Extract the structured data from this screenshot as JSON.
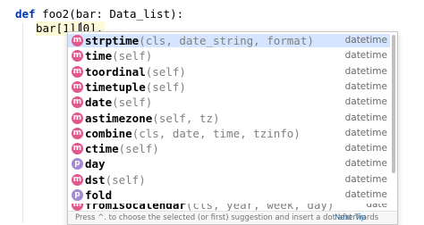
{
  "editor": {
    "line1": {
      "keyword": "def",
      "text": "foo2(bar: Data_list):"
    },
    "line2": {
      "text": "bar[1][0]."
    }
  },
  "completion": {
    "items": [
      {
        "icon": "m",
        "icon_name": "method-icon",
        "name": "strptime",
        "params": "(cls, date_string, format)",
        "type": "datetime",
        "selected": true
      },
      {
        "icon": "m",
        "icon_name": "method-icon",
        "name": "time",
        "params": "(self)",
        "type": "datetime"
      },
      {
        "icon": "m",
        "icon_name": "method-icon",
        "name": "toordinal",
        "params": "(self)",
        "type": "datetime"
      },
      {
        "icon": "m",
        "icon_name": "method-icon",
        "name": "timetuple",
        "params": "(self)",
        "type": "datetime"
      },
      {
        "icon": "m",
        "icon_name": "method-icon",
        "name": "date",
        "params": "(self)",
        "type": "datetime"
      },
      {
        "icon": "m",
        "icon_name": "method-icon",
        "name": "astimezone",
        "params": "(self, tz)",
        "type": "datetime"
      },
      {
        "icon": "m",
        "icon_name": "method-icon",
        "name": "combine",
        "params": "(cls, date, time, tzinfo)",
        "type": "datetime"
      },
      {
        "icon": "m",
        "icon_name": "method-icon",
        "name": "ctime",
        "params": "(self)",
        "type": "datetime"
      },
      {
        "icon": "p",
        "icon_name": "property-icon",
        "name": "day",
        "params": "",
        "type": "datetime"
      },
      {
        "icon": "m",
        "icon_name": "method-icon",
        "name": "dst",
        "params": "(self)",
        "type": "datetime"
      },
      {
        "icon": "p",
        "icon_name": "property-icon",
        "name": "fold",
        "params": "",
        "type": "datetime"
      }
    ],
    "partial_item": {
      "icon": "m",
      "name": "fromisocalendar",
      "params": "(cls, year, week, day)",
      "type": "date"
    },
    "footer": {
      "hint": "Press ^. to choose the selected (or first) suggestion and insert a dot afterwards",
      "next_tip": "Next Tip"
    }
  },
  "colors": {
    "selection": "#d5e4ff",
    "method_icon": "#e0588c",
    "property_icon": "#a489d4",
    "link": "#2470b3"
  }
}
